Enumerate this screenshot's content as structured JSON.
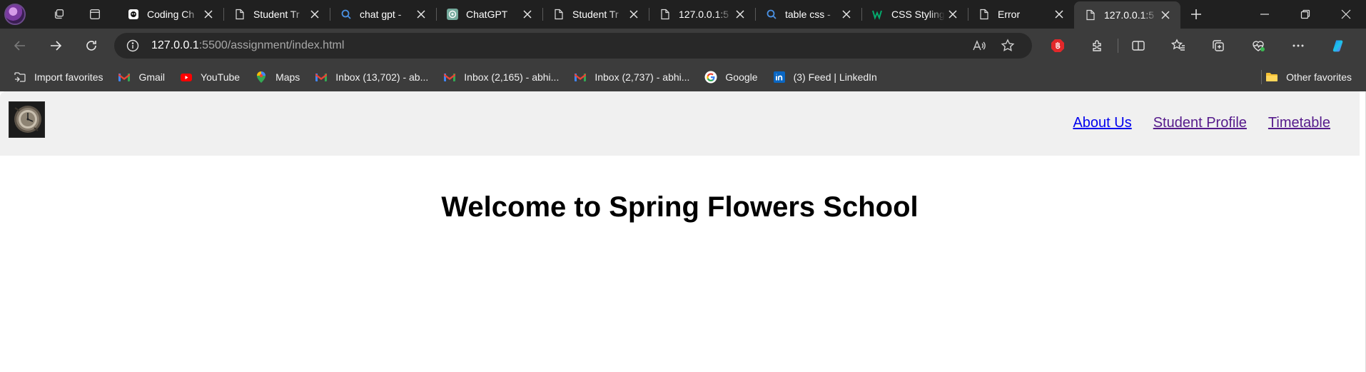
{
  "browser": {
    "tabs": [
      {
        "title": "Coding Ch",
        "icon": "coding-ninja-icon",
        "active": false
      },
      {
        "title": "Student Tr",
        "icon": "page-icon",
        "active": false
      },
      {
        "title": "chat gpt -",
        "icon": "search-icon",
        "active": false
      },
      {
        "title": "ChatGPT",
        "icon": "chatgpt-icon",
        "active": false
      },
      {
        "title": "Student Tr",
        "icon": "page-icon",
        "active": false
      },
      {
        "title": "127.0.0.1:5",
        "icon": "page-icon",
        "active": false
      },
      {
        "title": "table css -",
        "icon": "search-icon",
        "active": false
      },
      {
        "title": "CSS Styling",
        "icon": "w3schools-icon",
        "active": false
      },
      {
        "title": "Error",
        "icon": "page-icon",
        "active": false
      },
      {
        "title": "127.0.0.1:5",
        "icon": "page-icon",
        "active": true
      }
    ],
    "address": {
      "host": "127.0.0.1",
      "path": ":5500/assignment/index.html"
    },
    "bookmarks": [
      {
        "label": "Import favorites",
        "icon": "import-icon"
      },
      {
        "label": "Gmail",
        "icon": "gmail-icon"
      },
      {
        "label": "YouTube",
        "icon": "youtube-icon"
      },
      {
        "label": "Maps",
        "icon": "maps-icon"
      },
      {
        "label": "Inbox (13,702) - ab...",
        "icon": "gmail-icon"
      },
      {
        "label": "Inbox (2,165) - abhi...",
        "icon": "gmail-icon"
      },
      {
        "label": "Inbox (2,737) - abhi...",
        "icon": "gmail-icon"
      },
      {
        "label": "Google",
        "icon": "google-icon"
      },
      {
        "label": "(3) Feed | LinkedIn",
        "icon": "linkedin-icon"
      }
    ],
    "other_favorites": "Other favorites"
  },
  "site": {
    "nav": [
      {
        "label": "About Us",
        "state": "link"
      },
      {
        "label": "Student Profile",
        "state": "visited"
      },
      {
        "label": "Timetable",
        "state": "visited"
      }
    ],
    "heading": "Welcome to Spring Flowers School"
  },
  "colors": {
    "link": "#0000ee",
    "visited": "#551a8b",
    "header_bg": "#f0f0f0",
    "tabstrip_bg": "#202020",
    "toolbar_bg": "#3c3c3c"
  }
}
